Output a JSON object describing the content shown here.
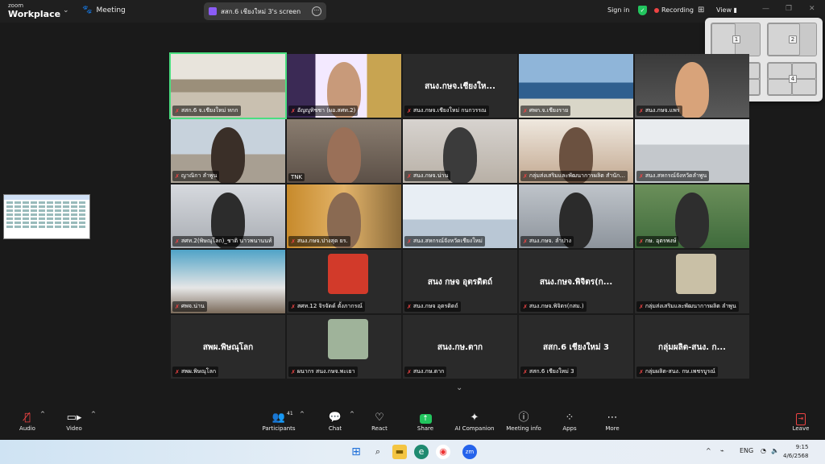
{
  "app": {
    "brand_small": "zoom",
    "brand_main": "Workplace"
  },
  "topbar": {
    "meeting_label": "Meeting",
    "share_title": "สสก.6 เชียงใหม่ 3's screen",
    "signin": "Sign in",
    "recording": "Recording",
    "view": "View"
  },
  "snap_layouts": [
    "1",
    "2",
    "3",
    "4"
  ],
  "tiles": [
    {
      "label": "สสก.6 จ.เชียงใหม่ หกก",
      "center": ""
    },
    {
      "label": "อัญญูทิชชา (ผอ.สศท.2)",
      "center": ""
    },
    {
      "label": "สนง.กษจ.เชียงใหม่ กนกวรรณ",
      "center": "สนง.กษจ.เชียงให..."
    },
    {
      "label": "ศพก.จ.เชียงราย",
      "center": ""
    },
    {
      "label": "สนง.กษจ.แพร่",
      "center": ""
    },
    {
      "label": "ญาณิกา ลำพูน",
      "center": ""
    },
    {
      "label": "TNK",
      "center": ""
    },
    {
      "label": "สนง.กษจ.น่าน",
      "center": ""
    },
    {
      "label": "กลุ่มส่งเสริมและพัฒนาการผลิต สำนัก...",
      "center": ""
    },
    {
      "label": "สนง.สหกรณ์จังหวัดลำพูน",
      "center": ""
    },
    {
      "label": "สศท.2(พิษณุโลก)_ชาติ นาวพนานนท์",
      "center": ""
    },
    {
      "label": "สนง.กษจ.ปางสุด ยร.",
      "center": ""
    },
    {
      "label": "สนง.สหกรณ์จังหวัดเชียงใหม่",
      "center": ""
    },
    {
      "label": "สนง.กษจ. ลำปาง",
      "center": ""
    },
    {
      "label": "กษ. อุตรพงษ์",
      "center": ""
    },
    {
      "label": "ศพจ.น่าน",
      "center": ""
    },
    {
      "label": "สศท.12 จิรจัดด์ ตั้งภากรณ์",
      "center": ""
    },
    {
      "label": "สนง.กษจ อุตรดิตถ์",
      "center": "สนง กษจ อุตรดิตถ์"
    },
    {
      "label": "สนง.กษจ.พิจิตร(กสม.)",
      "center": "สนง.กษจ.พิจิตร(ก..."
    },
    {
      "label": "กลุ่มส่งเสริมและพัฒนาการผลิต ลำพูน",
      "center": ""
    },
    {
      "label": "สพผ.พิษณุโลก",
      "center": "สพผ.พิษณุโลก"
    },
    {
      "label": "ผนากร สนง.กษจ.พะเยา",
      "center": ""
    },
    {
      "label": "สนง.กษ.ตาก",
      "center": "สนง.กษ.ตาก"
    },
    {
      "label": "สสก.6 เชียงใหม่ 3",
      "center": "สสก.6 เชียงใหม่ 3"
    },
    {
      "label": "กลุ่มผลิต-สนง. กษ.เพชรบูรณ์",
      "center": "กลุ่มผลิต-สนง. ก..."
    }
  ],
  "toolbar": {
    "audio": "Audio",
    "video": "Video",
    "participants": "Participants",
    "participants_count": "41",
    "chat": "Chat",
    "react": "React",
    "share": "Share",
    "ai_companion": "AI Companion",
    "meeting_info": "Meeting info",
    "apps": "Apps",
    "more": "More",
    "leave": "Leave"
  },
  "taskbar": {
    "lang": "ENG",
    "time": "9:15",
    "date": "4/6/2568"
  },
  "colors": {
    "active_border": "#4ade80",
    "share_green": "#22c55e",
    "mute_red": "#ef4444",
    "record_red": "#ef4444"
  }
}
